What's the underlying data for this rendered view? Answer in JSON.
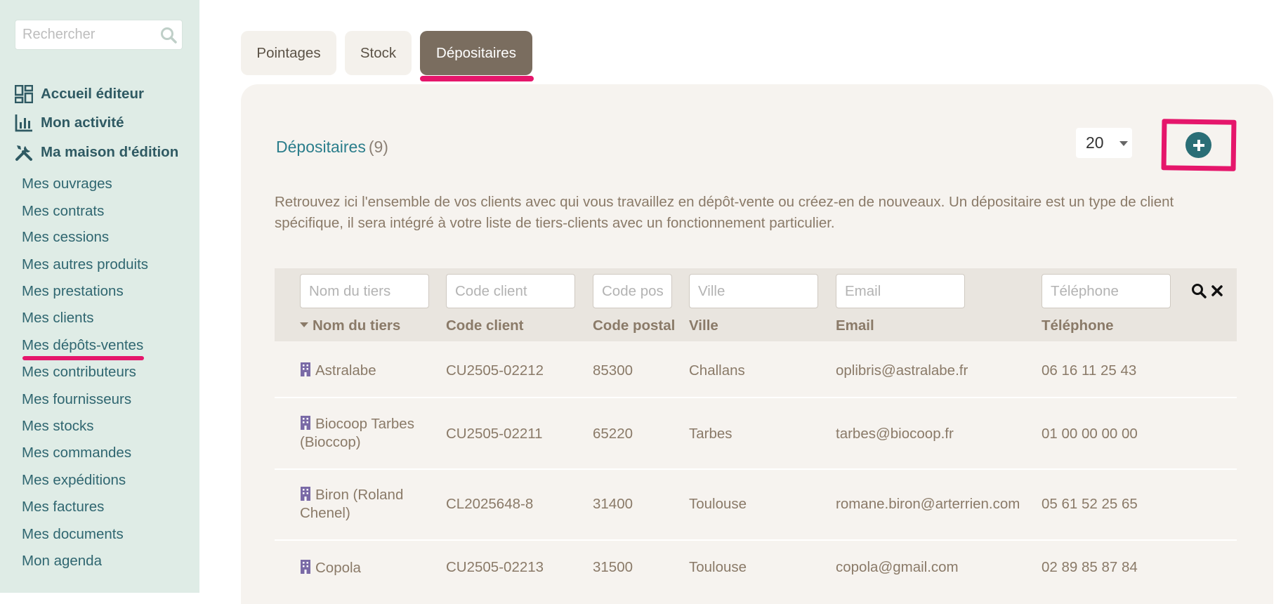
{
  "sidebar": {
    "search_placeholder": "Rechercher",
    "main_items": [
      {
        "label": "Accueil éditeur",
        "icon": "dashboard-icon"
      },
      {
        "label": "Mon activité",
        "icon": "chart-icon"
      },
      {
        "label": "Ma maison d'édition",
        "icon": "tools-icon"
      }
    ],
    "sub_items": [
      {
        "label": "Mes ouvrages"
      },
      {
        "label": "Mes contrats"
      },
      {
        "label": "Mes cessions"
      },
      {
        "label": "Mes autres produits"
      },
      {
        "label": "Mes prestations"
      },
      {
        "label": "Mes clients"
      },
      {
        "label": "Mes dépôts-ventes",
        "active": true
      },
      {
        "label": "Mes contributeurs"
      },
      {
        "label": "Mes fournisseurs"
      },
      {
        "label": "Mes stocks"
      },
      {
        "label": "Mes commandes"
      },
      {
        "label": "Mes expéditions"
      },
      {
        "label": "Mes factures"
      },
      {
        "label": "Mes documents"
      },
      {
        "label": "Mon agenda"
      }
    ]
  },
  "tabs": [
    {
      "label": "Pointages"
    },
    {
      "label": "Stock"
    },
    {
      "label": "Dépositaires",
      "active": true
    }
  ],
  "panel": {
    "title": "Dépositaires",
    "count": "(9)",
    "per_page": "20",
    "description": "Retrouvez ici l'ensemble de vos clients avec qui vous travaillez en dépôt-vente ou créez-en de nouveaux. Un dépositaire est un type de client spécifique, il sera intégré à votre liste de tiers-clients avec un fonctionnement particulier."
  },
  "table": {
    "filters": {
      "name": "Nom du tiers",
      "code": "Code client",
      "postal": "Code pos",
      "city": "Ville",
      "email": "Email",
      "phone": "Téléphone"
    },
    "columns": {
      "name": "Nom du tiers",
      "code": "Code client",
      "postal": "Code postal",
      "city": "Ville",
      "email": "Email",
      "phone": "Téléphone"
    },
    "rows": [
      {
        "name": "Astralabe",
        "code": "CU2505-02212",
        "postal": "85300",
        "city": "Challans",
        "email": "oplibris@astralabe.fr",
        "phone": "06 16 11 25 43"
      },
      {
        "name": "Biocoop Tarbes",
        "name2": "(Bioccop)",
        "code": "CU2505-02211",
        "postal": "65220",
        "city": "Tarbes",
        "email": "tarbes@biocoop.fr",
        "phone": "01 00 00 00 00"
      },
      {
        "name": "Biron (Roland",
        "name2": "Chenel)",
        "code": "CL2025648-8",
        "postal": "31400",
        "city": "Toulouse",
        "email": "romane.biron@arterrien.com",
        "phone": "05 61 52 25 65"
      },
      {
        "name": "Copola",
        "code": "CU2505-02213",
        "postal": "31500",
        "city": "Toulouse",
        "email": "copola@gmail.com",
        "phone": "02 89 85 87 84"
      }
    ]
  },
  "colors": {
    "sidebar_bg": "#dfece6",
    "active_tab": "#7a6d5f",
    "highlight": "#e5166b",
    "teal": "#2a7d8b"
  }
}
